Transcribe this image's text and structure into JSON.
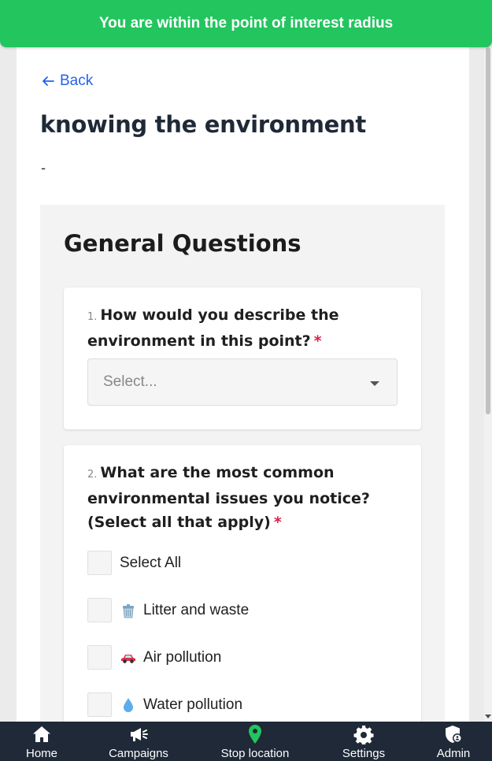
{
  "toast": {
    "message": "You are within the point of interest radius"
  },
  "header": {
    "back_label": "Back",
    "title": "knowing the environment",
    "description": "-"
  },
  "section": {
    "title": "General Questions",
    "questions": [
      {
        "number": "1.",
        "text": "How would you describe the environment in this point?",
        "required_mark": "*",
        "placeholder": "Select..."
      },
      {
        "number": "2.",
        "text": "What are the most common environmental issues you notice? (Select all that apply)",
        "required_mark": "*",
        "options": [
          {
            "label": "Select All",
            "icon": ""
          },
          {
            "label": "Litter and waste",
            "icon": "trash-can-icon"
          },
          {
            "label": "Air pollution",
            "icon": "car-icon"
          },
          {
            "label": "Water pollution",
            "icon": "water-drop-icon"
          }
        ]
      }
    ]
  },
  "nav": {
    "items": [
      {
        "label": "Home",
        "icon": "home-icon"
      },
      {
        "label": "Campaigns",
        "icon": "megaphone-icon"
      },
      {
        "label": "Stop location",
        "icon": "location-pin-icon"
      },
      {
        "label": "Settings",
        "icon": "gear-icon"
      },
      {
        "label": "Admin",
        "icon": "admin-shield-icon"
      }
    ]
  },
  "colors": {
    "toast": "#22c55e",
    "link": "#2563eb",
    "required": "#e11d48",
    "nav_bg": "#1f2937",
    "pin": "#22c55e"
  }
}
